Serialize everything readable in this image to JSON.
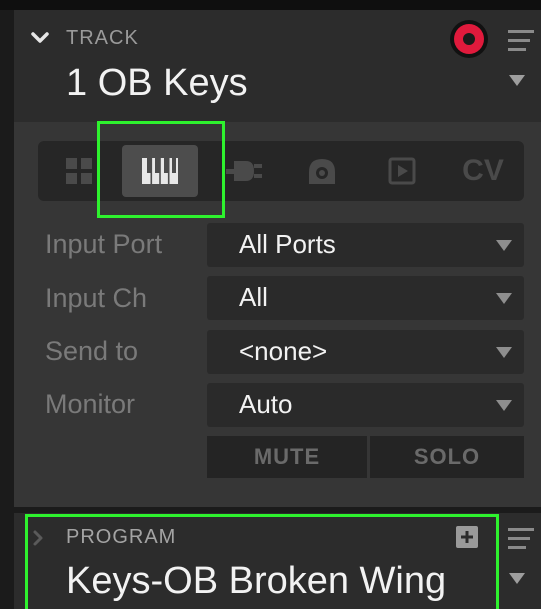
{
  "track": {
    "section_label": "TRACK",
    "name": "1 OB Keys"
  },
  "tabs": [
    {
      "id": "grid",
      "icon": "grid-icon",
      "selected": false
    },
    {
      "id": "midi",
      "icon": "piano-keys-icon",
      "selected": true
    },
    {
      "id": "plugin",
      "icon": "plug-icon",
      "selected": false
    },
    {
      "id": "audio",
      "icon": "speaker-icon",
      "selected": false
    },
    {
      "id": "sample",
      "icon": "frame-icon",
      "selected": false
    },
    {
      "id": "cv",
      "label": "CV",
      "selected": false
    }
  ],
  "rows": {
    "input_port": {
      "label": "Input Port",
      "value": "All Ports"
    },
    "input_ch": {
      "label": "Input Ch",
      "value": "All"
    },
    "send_to": {
      "label": "Send to",
      "value": "<none>"
    },
    "monitor": {
      "label": "Monitor",
      "value": "Auto"
    }
  },
  "buttons": {
    "mute": "MUTE",
    "solo": "SOLO"
  },
  "program": {
    "section_label": "PROGRAM",
    "name": "Keys-OB Broken Wing"
  },
  "colors": {
    "highlight": "#2ef22e",
    "record": "#e01a3c",
    "panel_dark": "#2c2c2c",
    "panel_body": "#363636"
  }
}
